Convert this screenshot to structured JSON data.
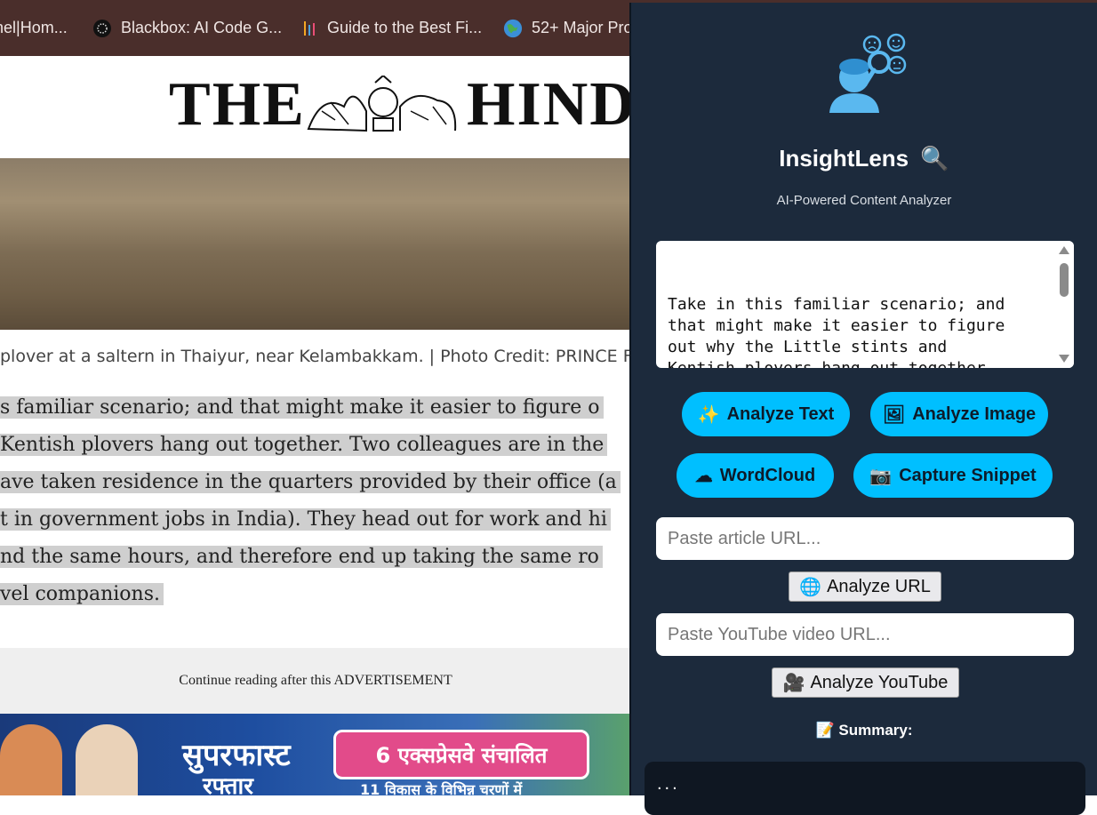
{
  "bookmarks": [
    {
      "label": "nel|Hom...",
      "icon": "page-icon"
    },
    {
      "label": "Blackbox: AI Code G...",
      "icon": "blackbox-icon"
    },
    {
      "label": "Guide to the Best Fi...",
      "icon": "bars-icon"
    },
    {
      "label": "52+ Major Pro",
      "icon": "globe-icon"
    }
  ],
  "page": {
    "masthead_left": "THE",
    "masthead_right": "HIND",
    "caption": "plover at a saltern in Thaiyur, near Kelambakkam. | Photo Credit: PRINCE FR",
    "article_lines": [
      "s familiar scenario; and that might make it easier to figure o",
      "Kentish plovers hang out together. Two colleagues are in the",
      "ave taken residence in the quarters provided by their office (a",
      "t in government jobs in India). They head out for work and hi",
      "nd the same hours, and therefore end up taking the same ro",
      "vel companions."
    ],
    "ad_notice": "Continue reading after this ADVERTISEMENT",
    "banner_text": "सुपरफास्ट",
    "banner_text2": "रफ्तार",
    "banner_pill": "6 एक्सप्रेसवे संचालित",
    "banner_pill_sub": "11 विकास के विभिन्न चरणों में"
  },
  "extension": {
    "title": "InsightLens",
    "title_icon": "🔍",
    "subtitle": "AI-Powered Content Analyzer",
    "textarea_value": "Take in this familiar scenario; and\nthat might make it easier to figure\nout why the Little stints and\nKentish plovers hang out together.\nTwo colleagues are in the same\ndepartment, and they have taken",
    "buttons": {
      "analyze_text": "Analyze Text",
      "analyze_text_icon": "✨",
      "analyze_image": "Analyze Image",
      "analyze_image_icon": "🖼",
      "wordcloud": "WordCloud",
      "wordcloud_icon": "☁",
      "capture_snippet": "Capture Snippet",
      "capture_snippet_icon": "📷"
    },
    "url_input_placeholder": "Paste article URL...",
    "analyze_url": "Analyze URL",
    "analyze_url_icon": "🌐",
    "youtube_input_placeholder": "Paste YouTube video URL...",
    "analyze_youtube": "Analyze YouTube",
    "analyze_youtube_icon": "🎥",
    "summary_label": "Summary:",
    "summary_icon": "📝",
    "summary_text": "...",
    "accent_color": "#00bfff",
    "panel_bg": "#1c2a3c"
  }
}
